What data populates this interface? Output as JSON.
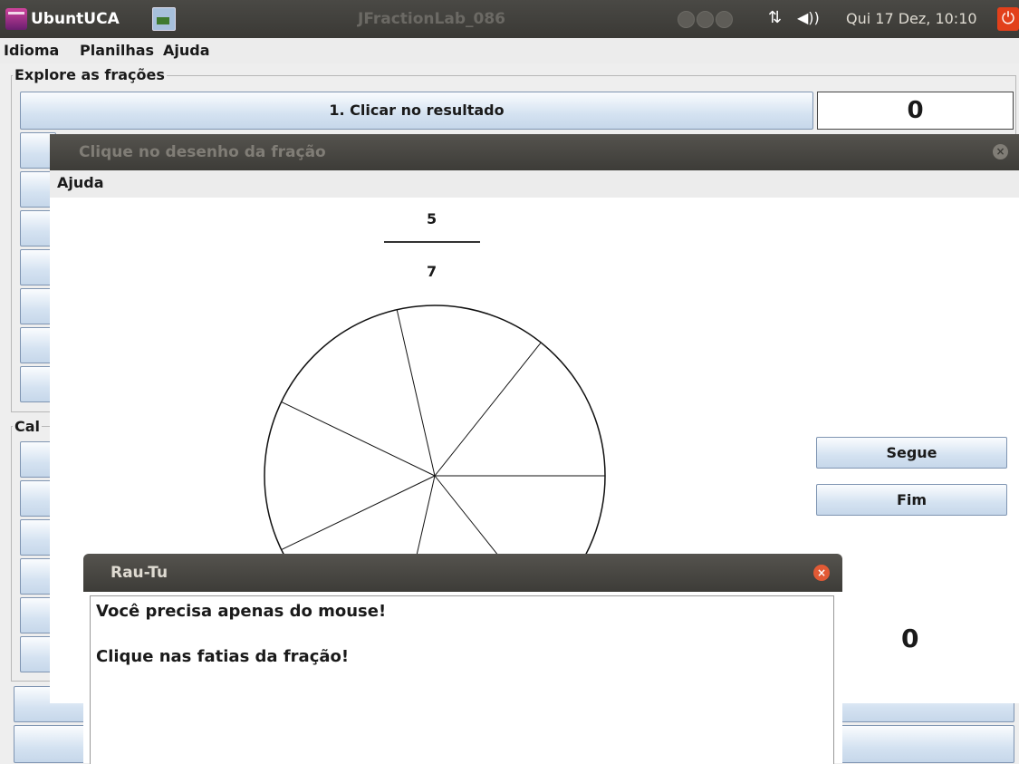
{
  "top_panel": {
    "app_name": "UbuntUCA",
    "window_title": "JFractionLab_086",
    "network_glyph": "⇅",
    "volume_glyph": "◀))",
    "clock": "Qui 17 Dez, 10:10",
    "power_glyph": "⏻"
  },
  "menubar": {
    "items": [
      "Idioma",
      "Planilhas",
      "Ajuda"
    ]
  },
  "explore": {
    "group_title": "Explore as frações",
    "first_button": "1. Clicar no resultado",
    "score": "0"
  },
  "calc": {
    "group_title_partial": "Cal"
  },
  "fraction_dialog": {
    "title": "Clique no desenho da fração",
    "close_glyph": "×",
    "menu": "Ajuda",
    "numerator": "5",
    "denominator": "7",
    "slices": 7,
    "next_button": "Segue",
    "end_button": "Fim",
    "score": "0"
  },
  "help_dialog": {
    "title": "Rau-Tu",
    "close_glyph": "×",
    "line1": "Você precisa apenas do mouse!",
    "line2": "Clique nas fatias da fração!"
  }
}
